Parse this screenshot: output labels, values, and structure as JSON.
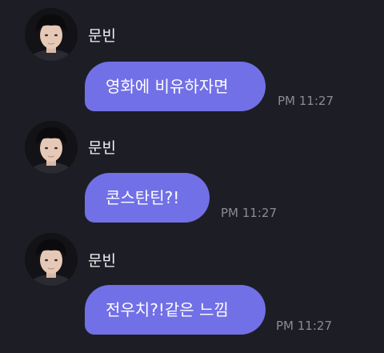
{
  "theme": {
    "background": "#1d1e25",
    "bubble_color": "#7270e6",
    "name_color": "#f2f2f4",
    "timestamp_color": "#8a8b93"
  },
  "messages": [
    {
      "sender": "문빈",
      "avatar_icon": "profile-photo",
      "text": "영화에 비유하자면",
      "time": "PM 11:27"
    },
    {
      "sender": "문빈",
      "avatar_icon": "profile-photo",
      "text": "콘스탄틴?!",
      "time": "PM 11:27"
    },
    {
      "sender": "문빈",
      "avatar_icon": "profile-photo",
      "text": "전우치?!같은 느낌",
      "time": "PM 11:27"
    }
  ]
}
